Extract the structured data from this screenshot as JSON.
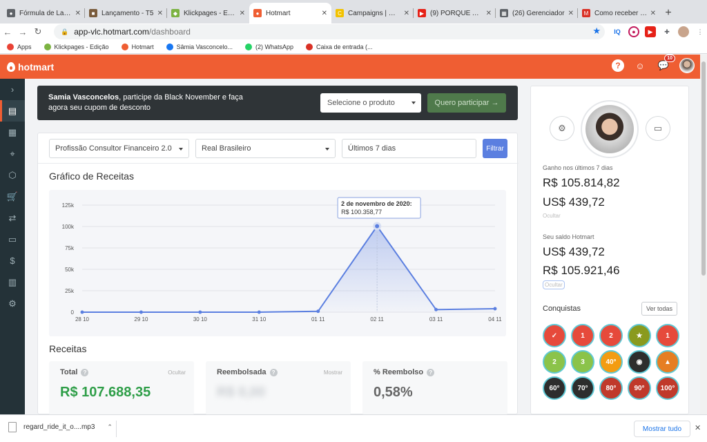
{
  "browser": {
    "tabs": [
      {
        "title": "Fórmula de Lançam",
        "color": "#5f6368",
        "glyph": "●"
      },
      {
        "title": "Lançamento - T5",
        "color": "#7a5c3c",
        "glyph": "■"
      },
      {
        "title": "Klickpages - Ediçã",
        "color": "#7cb342",
        "glyph": "◆"
      },
      {
        "title": "Hotmart",
        "color": "#ef5e33",
        "glyph": "●"
      },
      {
        "title": "Campaigns | Mailc",
        "color": "#f2c200",
        "glyph": "C"
      },
      {
        "title": "(9) PORQUE ALGU",
        "color": "#e62117",
        "glyph": "▶"
      },
      {
        "title": "(26) Gerenciador",
        "color": "#5f6368",
        "glyph": "▦"
      },
      {
        "title": "Como receber seu",
        "color": "#d93025",
        "glyph": "M"
      }
    ],
    "url_host": "app-vlc.hotmart.com",
    "url_path": "/dashboard",
    "bookmarks": [
      {
        "label": "Apps",
        "color": "#e94235"
      },
      {
        "label": "Klickpages - Edição",
        "color": "#7cb342"
      },
      {
        "label": "Hotmart",
        "color": "#ef5e33"
      },
      {
        "label": "Sâmia Vasconcelo...",
        "color": "#1877f2"
      },
      {
        "label": "(2) WhatsApp",
        "color": "#25d366"
      },
      {
        "label": "Caixa de entrada (...",
        "color": "#d93025"
      }
    ]
  },
  "app": {
    "brand": "hotmart",
    "notifications": "10"
  },
  "banner": {
    "name": "Samia Vasconcelos",
    "text": ", participe da Black November e faça agora seu cupom de desconto",
    "select_placeholder": "Selecione o produto",
    "button": "Quero participar →"
  },
  "filters": {
    "product": "Profissão Consultor Financeiro 2.0",
    "currency": "Real Brasileiro",
    "period": "Últimos 7 dias",
    "button": "Filtrar"
  },
  "chart_title": "Gráfico de Receitas",
  "chart_data": {
    "type": "area",
    "categories": [
      "28 10",
      "29 10",
      "30 10",
      "31 10",
      "01 11",
      "02 11",
      "03 11",
      "04 11"
    ],
    "values": [
      0,
      0,
      0,
      0,
      1000,
      100358.77,
      3000,
      4000
    ],
    "yticks": [
      "125k",
      "100k",
      "75k",
      "50k",
      "25k",
      "0"
    ],
    "ylim": [
      0,
      125000
    ],
    "tooltip_title": "2 de novembro de 2020:",
    "tooltip_value": "R$ 100.358,77",
    "tooltip_index": 5,
    "color": "#5b7fe0"
  },
  "revenue": {
    "title": "Receitas",
    "total_label": "Total",
    "total_value": "R$ 107.688,35",
    "hide": "Ocultar",
    "refunded_label": "Reembolsada",
    "refunded_value": "R$ 0,00",
    "show": "Mostrar",
    "refund_pct_label": "% Reembolso",
    "refund_pct_value": "0,58%"
  },
  "profile": {
    "earned_label": "Ganho nos últimos 7 dias",
    "earned_brl": "R$ 105.814,82",
    "earned_usd": "US$ 439,72",
    "hide": "Ocultar",
    "balance_label": "Seu saldo Hotmart",
    "balance_usd": "US$ 439,72",
    "balance_brl": "R$ 105.921,46",
    "achievements": "Conquistas",
    "see_all": "Ver todas",
    "medals": [
      {
        "label": "✓",
        "bg": "#e64a3b"
      },
      {
        "label": "1",
        "bg": "#e64a3b"
      },
      {
        "label": "2",
        "bg": "#e64a3b"
      },
      {
        "label": "★",
        "bg": "#8a9a1e"
      },
      {
        "label": "1",
        "bg": "#e64a3b"
      },
      {
        "label": "2",
        "bg": "#8bc34a"
      },
      {
        "label": "3",
        "bg": "#8bc34a"
      },
      {
        "label": "40°",
        "bg": "#f39c12"
      },
      {
        "label": "◉",
        "bg": "#2d2d2d"
      },
      {
        "label": "▲",
        "bg": "#e67e22"
      },
      {
        "label": "60°",
        "bg": "#2d2d2d"
      },
      {
        "label": "70°",
        "bg": "#2d2d2d"
      },
      {
        "label": "80°",
        "bg": "#c0392b"
      },
      {
        "label": "90°",
        "bg": "#c0392b"
      },
      {
        "label": "100°",
        "bg": "#c0392b"
      }
    ]
  },
  "download": {
    "file": "regard_ride_it_o....mp3",
    "show_all": "Mostrar tudo"
  }
}
